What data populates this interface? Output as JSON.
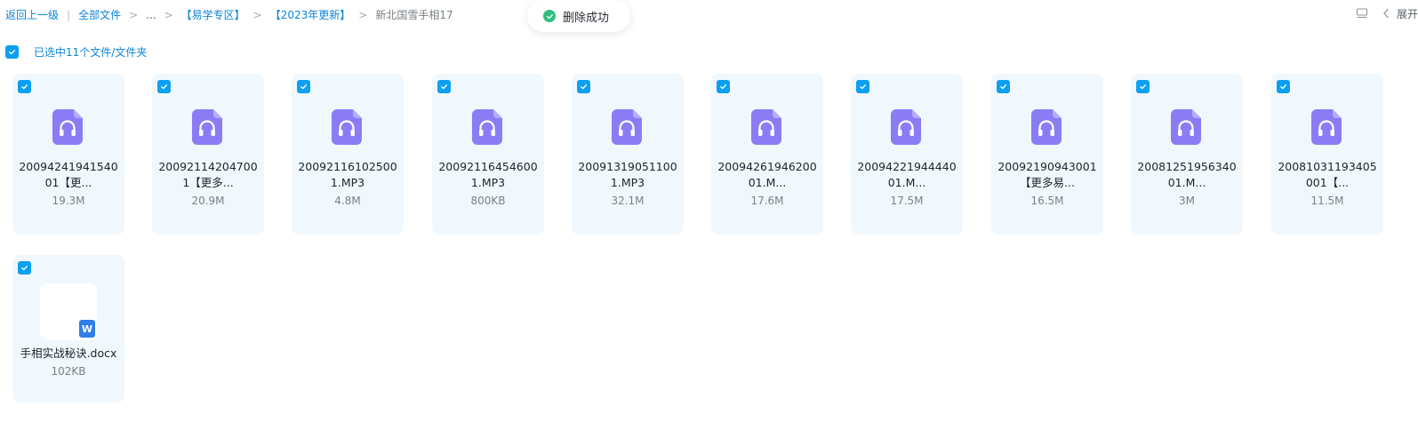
{
  "breadcrumb": {
    "back": "返回上一级",
    "separator": "|",
    "items": [
      "全部文件",
      "...",
      "【易学专区】",
      "【2023年更新】"
    ],
    "current": "新北国雪手相17"
  },
  "toast": {
    "text": "删除成功",
    "icon": "check-circle-icon"
  },
  "toolbar": {
    "expand_label": "展开",
    "layout_icon": "layout-toggle-icon",
    "chevron_icon": "chevron-left-icon"
  },
  "selection": {
    "text": "已选中11个文件/文件夹",
    "checked": true
  },
  "files": [
    {
      "name_line1": "20094241941540",
      "name_line2": "01【更...",
      "size": "19.3M",
      "type": "audio"
    },
    {
      "name_line1": "20092114204700",
      "name_line2": "1【更多...",
      "size": "20.9M",
      "type": "audio"
    },
    {
      "name_line1": "20092116102500",
      "name_line2": "1.MP3",
      "size": "4.8M",
      "type": "audio"
    },
    {
      "name_line1": "20092116454600",
      "name_line2": "1.MP3",
      "size": "800KB",
      "type": "audio"
    },
    {
      "name_line1": "20091319051100",
      "name_line2": "1.MP3",
      "size": "32.1M",
      "type": "audio"
    },
    {
      "name_line1": "20094261946200",
      "name_line2": "01.M...",
      "size": "17.6M",
      "type": "audio"
    },
    {
      "name_line1": "20094221944440",
      "name_line2": "01.M...",
      "size": "17.5M",
      "type": "audio"
    },
    {
      "name_line1": "20092190943001",
      "name_line2": "【更多易...",
      "size": "16.5M",
      "type": "audio"
    },
    {
      "name_line1": "20081251956340",
      "name_line2": "01.M...",
      "size": "3M",
      "type": "audio"
    },
    {
      "name_line1": "20081031193405",
      "name_line2": "001【...",
      "size": "11.5M",
      "type": "audio"
    },
    {
      "name_line1": "手相实战秘诀.docx",
      "name_line2": "",
      "size": "102KB",
      "type": "docx"
    }
  ],
  "colors": {
    "accent": "#0d9ff0",
    "link": "#0d84d9",
    "audio_icon": "#8b7cf6",
    "card_bg": "#f1f8fd",
    "success": "#2fbe7e",
    "word_badge": "#2f7fe6"
  }
}
